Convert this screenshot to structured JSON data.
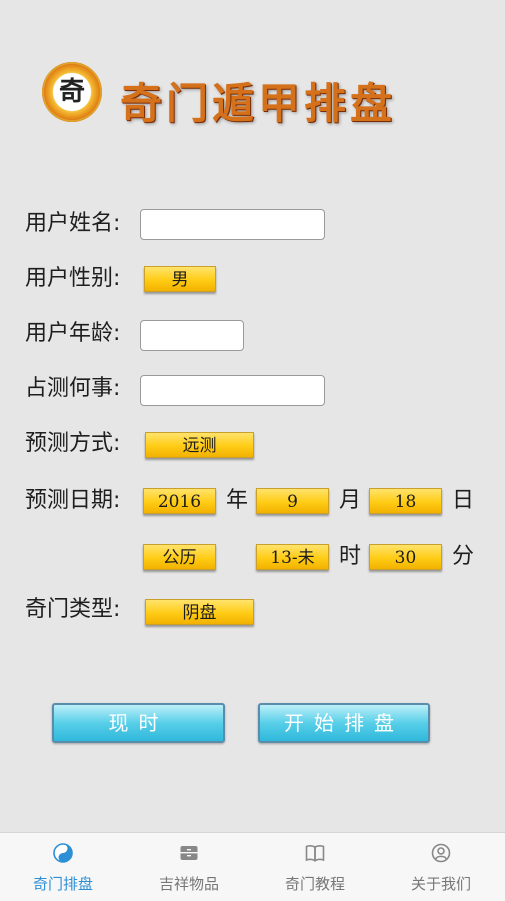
{
  "header": {
    "logo_char": "奇",
    "title": "奇门遁甲排盘"
  },
  "form": {
    "name_label": "用户姓名:",
    "name_value": "",
    "gender_label": "用户性别:",
    "gender_value": "男",
    "age_label": "用户年龄:",
    "age_value": "",
    "matter_label": "占测何事:",
    "matter_value": "",
    "method_label": "预测方式:",
    "method_value": "远测",
    "date_label": "预测日期:",
    "year_value": "2016",
    "year_unit": "年",
    "month_value": "9",
    "month_unit": "月",
    "day_value": "18",
    "day_unit": "日",
    "calendar_value": "公历",
    "hour_value": "13-未",
    "hour_unit": "时",
    "minute_value": "30",
    "minute_unit": "分",
    "type_label": "奇门类型:",
    "type_value": "阴盘"
  },
  "buttons": {
    "now": "现时",
    "start": "开始排盘"
  },
  "tabs": [
    {
      "label": "奇门排盘",
      "icon": "yin-yang-icon",
      "active": true
    },
    {
      "label": "吉祥物品",
      "icon": "archive-box-icon",
      "active": false
    },
    {
      "label": "奇门教程",
      "icon": "open-book-icon",
      "active": false
    },
    {
      "label": "关于我们",
      "icon": "user-circle-icon",
      "active": false
    }
  ],
  "colors": {
    "accent": "#2d8fd6",
    "pill": "#ffcc15",
    "button": "#58cfe8"
  }
}
